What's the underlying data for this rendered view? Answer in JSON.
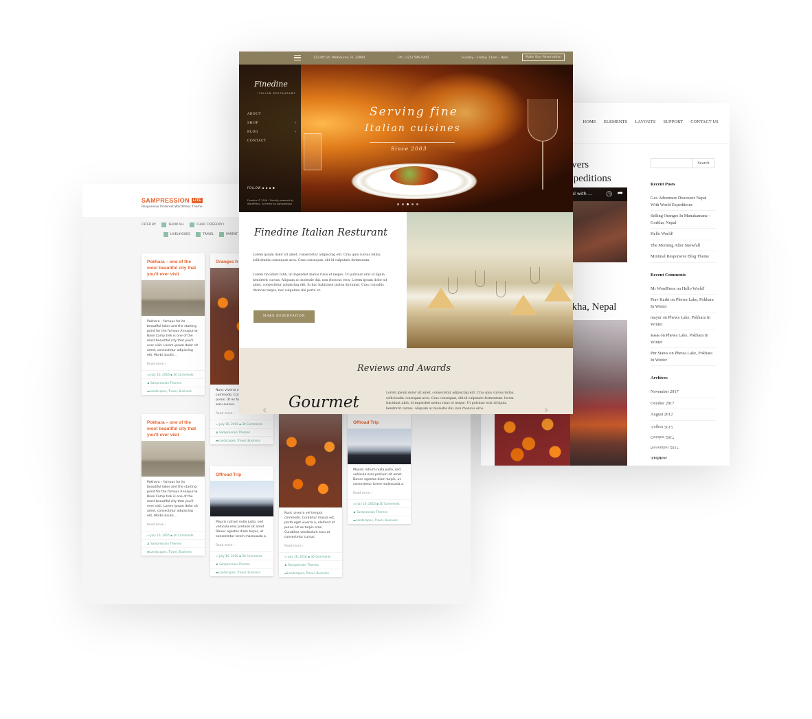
{
  "blog": {
    "menu": [
      "HOME",
      "ELEMENTS",
      "LAYOUTS",
      "SUPPORT",
      "CONTACT US"
    ],
    "post_title_1_line1": "covers",
    "post_title_1_line2": "Expeditions",
    "video_caption": "epal with ...",
    "post_title_2": "orkha, Nepal",
    "search_button": "Search",
    "recent_posts_heading": "Recent Posts",
    "recent_posts": [
      "Geo Adventure Discovers Nepal With World Expeditions",
      "Selling Oranges In Manakamana – Gorkha, Nepal",
      "Hello World!",
      "The Morning After Snowfall",
      "Minimal Responsive Blog Theme"
    ],
    "recent_comments_heading": "Recent Comments",
    "recent_comments": [
      "Mr WordPress on Hello World!",
      "Prav Karki on Phewa Lake, Pokhara In Winter",
      "mayur on Phewa Lake, Pokhara In Winter",
      "ಹಿಹಿಹಿ on Phewa Lake, Pokhara In Winter",
      "Pnr Status on Phewa Lake, Pokhara In Winter"
    ],
    "archives_heading": "Archives",
    "archives": [
      "November 2017",
      "October 2017",
      "August 2012"
    ],
    "mirror_items": [
      "August 2012",
      "October 2017",
      "November 2017",
      "Archives"
    ]
  },
  "pinterest": {
    "logo": "SAMPRESSION",
    "logo_badge": "LITE",
    "tagline": "Responsive Pinterest WordPress Theme",
    "filter_label": "FILTER BY:",
    "filters_row1": [
      "SHOW ALL",
      "CHILD CATEGORY I"
    ],
    "filters_row2": [
      "LIVELIHOODS",
      "TRAVEL",
      "PARENT"
    ],
    "cards": [
      {
        "title": "Pokhara – one of the most beautiful city that you'll ever visit",
        "excerpt": "Pokhara – famous for its beautiful lakes and the starting point for the famous Annapurna Base Camp trek is one of the most beautiful city that you'll ever visit. Lorem ipsum dolor sit amet, consectetur adipiscing elit. Morbi iaculis...",
        "read_more": "Read more ›",
        "date": "July 16, 2016",
        "comments": "30 Comments",
        "author": "Sampression Themes",
        "cats": "Landscapes, Travel, Business"
      },
      {
        "title": "Pokhara – one of the most beautiful city that you'll ever visit",
        "excerpt": "Pokhara – famous for its beautiful lakes and the starting point for the famous Annapurna Base Camp trek is one of the most beautiful city that you'll ever visit. Lorem ipsum dolor sit amet, consectetur adipiscing elit. Morbi iaculis...",
        "read_more": "Read more ›",
        "date": "July 16, 2016",
        "comments": "30 Comments",
        "author": "Sampression Themes",
        "cats": "Landscapes, Travel, Business"
      },
      {
        "title": "Oranges fr",
        "excerpt": "Nunc viverra vel tempor commodo. Cur porta eget viverr purus. Ut ex turp vestibulum arcu cursus.",
        "read_more": "Read more ›",
        "date": "July 16, 2016",
        "comments": "30 Comments",
        "author": "Sampression Themes",
        "cats": "Landscapes, Travel, Business"
      },
      {
        "title": "Offroad Trip",
        "excerpt": "Mauris rutrum nulla justo, sed vehicula eros pretium sit amet. Donec egestas diam turpis, ut consectetur lorem malesuada a.",
        "read_more": "Read more ›",
        "date": "July 16, 2016",
        "comments": "30 Comments",
        "author": "Sampression Themes",
        "cats": "Landscapes, Travel, Business"
      },
      {
        "title": "",
        "excerpt": "Nunc viverra vel tempor commodo. Curabitur massa est, porta eget viverra a, eleifend at purus. Ut ex turpis eros. Curabitur vestibulum arcu at consectetur cursus.",
        "read_more": "Read more ›",
        "date": "July 16, 2016",
        "comments": "30 Comments",
        "author": "Sampression Themes",
        "cats": "Landscapes, Travel, Business"
      },
      {
        "title": "Offroad Trip",
        "excerpt": "Mauris rutrum nulla justo, sed vehicula eros pretium sit amet. Donec egestas diam turpis, ut consectetur lorem malesuada a.",
        "read_more": "Read more ›",
        "date": "July 16, 2016",
        "comments": "30 Comments",
        "author": "Sampression Themes",
        "cats": "Landscapes, Travel, Business"
      }
    ]
  },
  "restaurant": {
    "address": "123 6th St. Melbourne, FL 32904",
    "phone": "Ph: (321) 596-5442",
    "hours": "Sunday – Friday: 11am – 9pm",
    "reservation_top": "Make Your Reservation",
    "brand": "Finedine",
    "brand_sub": "ITALIAN RESTAURANT",
    "nav": [
      "ABOUT",
      "SHOP",
      "BLOG",
      "CONTACT"
    ],
    "follow": "FOLLOW",
    "copyright": "Finedine © 2016 · Proudly powered by WordPress · A theme by Sampression",
    "hero_line1": "Serving fine",
    "hero_line2": "Italian cuisines",
    "hero_line3": "Since 2003",
    "about_title": "Finedine Italian Resturant",
    "about_p1": "Lorem ipsum dolor sit amet, consectetur adipiscing elit. Cras quis cursus tellus, sollicitudin consequat arcu. Cras consequat, elit id vulputate fermentum.",
    "about_p2": "Lorem tincidunt nibh, id imperdiet metus risus et neque. Ut pulvinar erat id ligula hendrerit cursus. Aliquam ac molestie dui, non rhoncus eros. Lorem ipsum dolor sit amet, consectetur adipiscing elit. In hac habitasse platea dictumst. Cras convallis rhoncus turpis, nec vulputate dui porta ut.",
    "make_reservation": "MAKE RESERVATION",
    "reviews_title": "Reviews and Awards",
    "review_text": "Lorem ipsum dolor sit amet, consectetur adipiscing elit. Cras quis cursus tellus, sollicitudin consequat arcu. Cras consequat, elit id vulputate fermentum. lorem tincidunt nibh, id imperdiet metus risus et neque. Ut pulvinar erat id ligula hendrerit cursus. Aliquam ac molestie dui, non rhoncus eros.",
    "award_logo": "Gourmet"
  },
  "colors": {
    "accent_orange": "#e8622a",
    "gold": "#9a8c63",
    "topbar": "#8c7f5e",
    "green_meta": "#5fa88a"
  }
}
